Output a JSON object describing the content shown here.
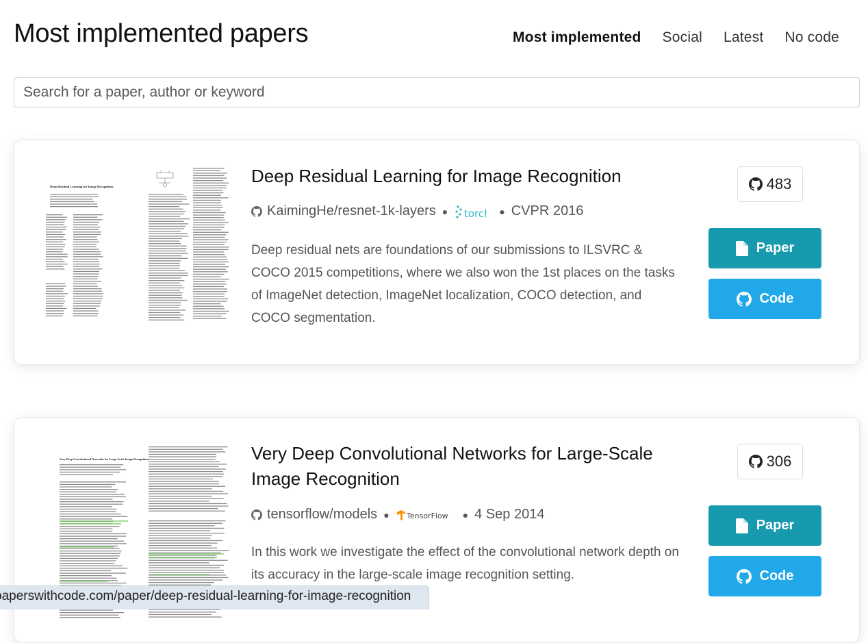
{
  "header": {
    "title": "Most implemented papers",
    "tabs": [
      {
        "label": "Most implemented",
        "active": true
      },
      {
        "label": "Social",
        "active": false
      },
      {
        "label": "Latest",
        "active": false
      },
      {
        "label": "No code",
        "active": false
      }
    ]
  },
  "search": {
    "placeholder": "Search for a paper, author or keyword"
  },
  "papers": [
    {
      "title": "Deep Residual Learning for Image Recognition",
      "repo": "KaimingHe/resnet-1k-layers",
      "framework": "torch",
      "framework_icon": "torch-logo",
      "venue": "CVPR 2016",
      "abstract": "Deep residual nets are foundations of our submissions to ILSVRC & COCO 2015 competitions, where we also won the 1st places on the tasks of ImageNet detection, ImageNet localization, COCO detection, and COCO segmentation.",
      "stars": "483",
      "paper_label": "Paper",
      "code_label": "Code",
      "thumbnail_heading": "Deep Residual Learning for Image Recognition"
    },
    {
      "title": "Very Deep Convolutional Networks for Large-Scale Image Recognition",
      "repo": "tensorflow/models",
      "framework": "TensorFlow",
      "framework_icon": "tensorflow-logo",
      "venue": "4 Sep 2014",
      "abstract": "In this work we investigate the effect of the convolutional network depth on its accuracy in the large-scale image recognition setting.",
      "stars": "306",
      "paper_label": "Paper",
      "code_label": "Code",
      "thumbnail_heading": "Very Deep Convolutional Networks for Large-Scale Image Recognition"
    }
  ],
  "status_bar": {
    "url": "paperswithcode.com/paper/deep-residual-learning-for-image-recognition"
  },
  "colors": {
    "paper_button": "#1799ae",
    "code_button": "#21a8e8",
    "torch_accent": "#2fb8c9",
    "tensorflow_accent": "#ff8f00"
  }
}
